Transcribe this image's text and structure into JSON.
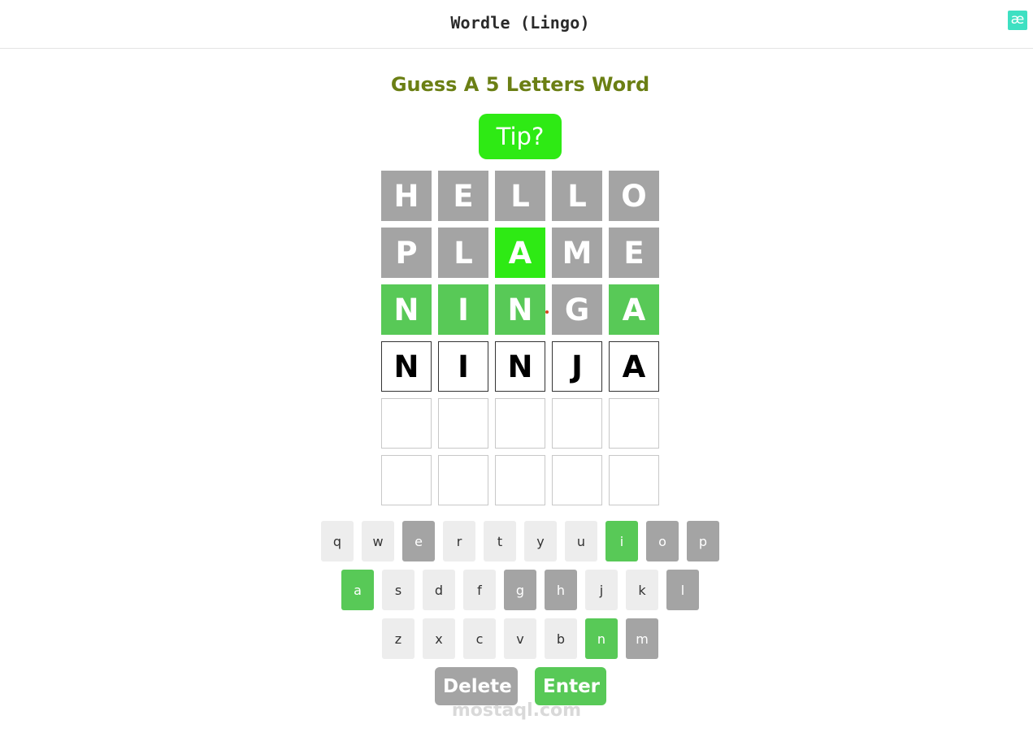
{
  "header": {
    "title": "Wordle (Lingo)",
    "logo_glyph": "æ"
  },
  "main": {
    "heading": "Guess A 5 Letters Word",
    "tip_label": "Tip?"
  },
  "board": {
    "rows": [
      [
        {
          "letter": "H",
          "state": "absent"
        },
        {
          "letter": "E",
          "state": "absent"
        },
        {
          "letter": "L",
          "state": "absent"
        },
        {
          "letter": "L",
          "state": "absent"
        },
        {
          "letter": "O",
          "state": "absent"
        }
      ],
      [
        {
          "letter": "P",
          "state": "absent"
        },
        {
          "letter": "L",
          "state": "absent"
        },
        {
          "letter": "A",
          "state": "present"
        },
        {
          "letter": "M",
          "state": "absent"
        },
        {
          "letter": "E",
          "state": "absent"
        }
      ],
      [
        {
          "letter": "N",
          "state": "correct"
        },
        {
          "letter": "I",
          "state": "correct"
        },
        {
          "letter": "N",
          "state": "correct"
        },
        {
          "letter": "G",
          "state": "absent"
        },
        {
          "letter": "A",
          "state": "correct"
        }
      ],
      [
        {
          "letter": "N",
          "state": "typed"
        },
        {
          "letter": "I",
          "state": "typed"
        },
        {
          "letter": "N",
          "state": "typed"
        },
        {
          "letter": "J",
          "state": "typed"
        },
        {
          "letter": "A",
          "state": "typed"
        }
      ],
      [
        {
          "letter": "",
          "state": "empty"
        },
        {
          "letter": "",
          "state": "empty"
        },
        {
          "letter": "",
          "state": "empty"
        },
        {
          "letter": "",
          "state": "empty"
        },
        {
          "letter": "",
          "state": "empty"
        }
      ],
      [
        {
          "letter": "",
          "state": "empty"
        },
        {
          "letter": "",
          "state": "empty"
        },
        {
          "letter": "",
          "state": "empty"
        },
        {
          "letter": "",
          "state": "empty"
        },
        {
          "letter": "",
          "state": "empty"
        }
      ]
    ]
  },
  "keyboard": {
    "rows": [
      [
        {
          "key": "q",
          "state": "unused"
        },
        {
          "key": "w",
          "state": "unused"
        },
        {
          "key": "e",
          "state": "absent"
        },
        {
          "key": "r",
          "state": "unused"
        },
        {
          "key": "t",
          "state": "unused"
        },
        {
          "key": "y",
          "state": "unused"
        },
        {
          "key": "u",
          "state": "unused"
        },
        {
          "key": "i",
          "state": "correct"
        },
        {
          "key": "o",
          "state": "absent"
        },
        {
          "key": "p",
          "state": "absent"
        }
      ],
      [
        {
          "key": "a",
          "state": "correct"
        },
        {
          "key": "s",
          "state": "unused"
        },
        {
          "key": "d",
          "state": "unused"
        },
        {
          "key": "f",
          "state": "unused"
        },
        {
          "key": "g",
          "state": "absent"
        },
        {
          "key": "h",
          "state": "absent"
        },
        {
          "key": "j",
          "state": "unused"
        },
        {
          "key": "k",
          "state": "unused"
        },
        {
          "key": "l",
          "state": "absent"
        }
      ],
      [
        {
          "key": "z",
          "state": "unused"
        },
        {
          "key": "x",
          "state": "unused"
        },
        {
          "key": "c",
          "state": "unused"
        },
        {
          "key": "v",
          "state": "unused"
        },
        {
          "key": "b",
          "state": "unused"
        },
        {
          "key": "n",
          "state": "correct"
        },
        {
          "key": "m",
          "state": "absent"
        }
      ]
    ],
    "delete_label": "Delete",
    "enter_label": "Enter"
  },
  "watermark": "mostaql.com",
  "colors": {
    "absent": "#a4a4a4",
    "present": "#2eea14",
    "correct": "#58c957",
    "unused_key": "#ededed",
    "heading": "#6b7f14",
    "logo": "#3ee0c2"
  }
}
